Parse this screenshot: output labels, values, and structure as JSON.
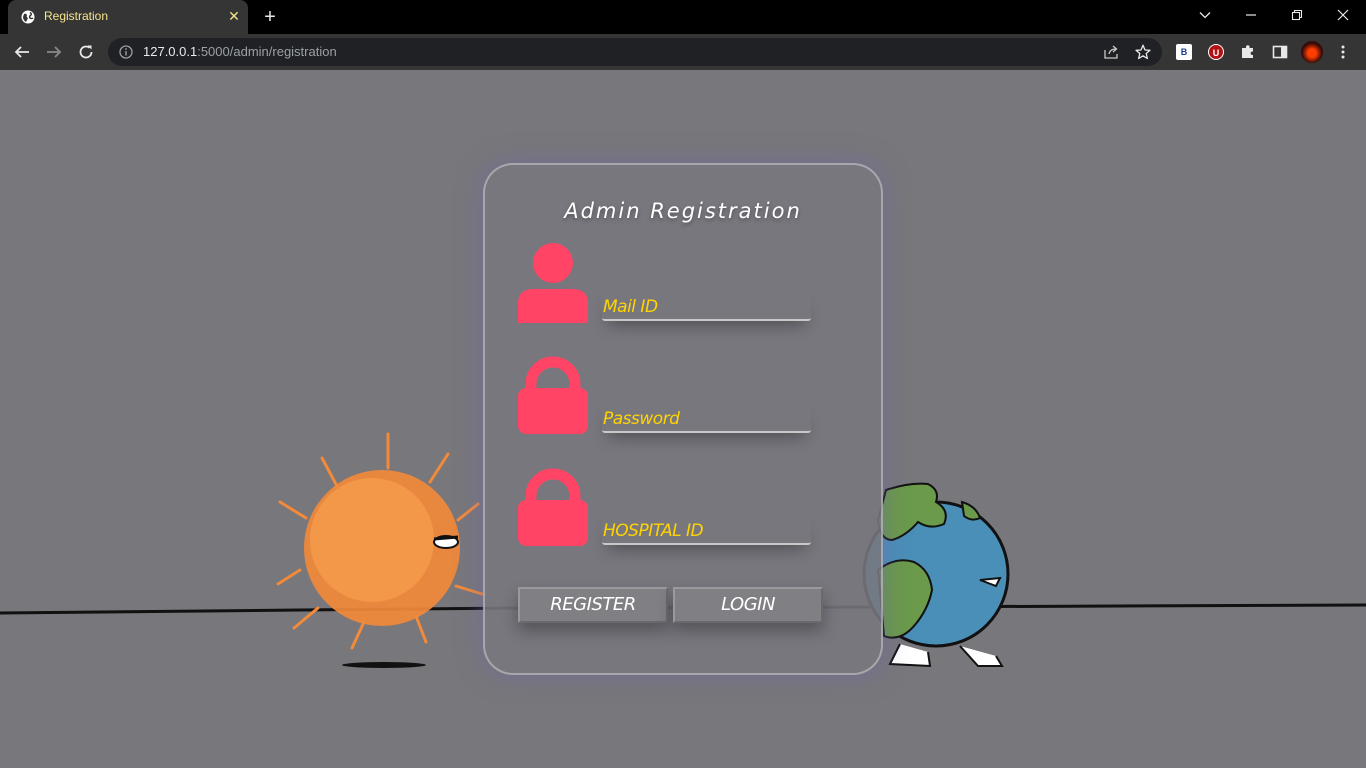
{
  "browser": {
    "tab": {
      "title": "Registration"
    },
    "url": {
      "host": "127.0.0.1",
      "rest": ":5000/admin/registration"
    },
    "extensions": {
      "b_label": "B",
      "u_label": "U"
    }
  },
  "form": {
    "title": "Admin Registration",
    "fields": [
      {
        "label": "Mail ID",
        "icon": "user-icon"
      },
      {
        "label": "Password",
        "icon": "lock-icon"
      },
      {
        "label": "HOSPITAL ID",
        "icon": "lock-icon"
      }
    ],
    "buttons": {
      "register": "REGISTER",
      "login": "LOGIN"
    }
  },
  "colors": {
    "accent_icon": "#ff4466",
    "field_label": "#ffd400",
    "page_background": "#78777b"
  }
}
